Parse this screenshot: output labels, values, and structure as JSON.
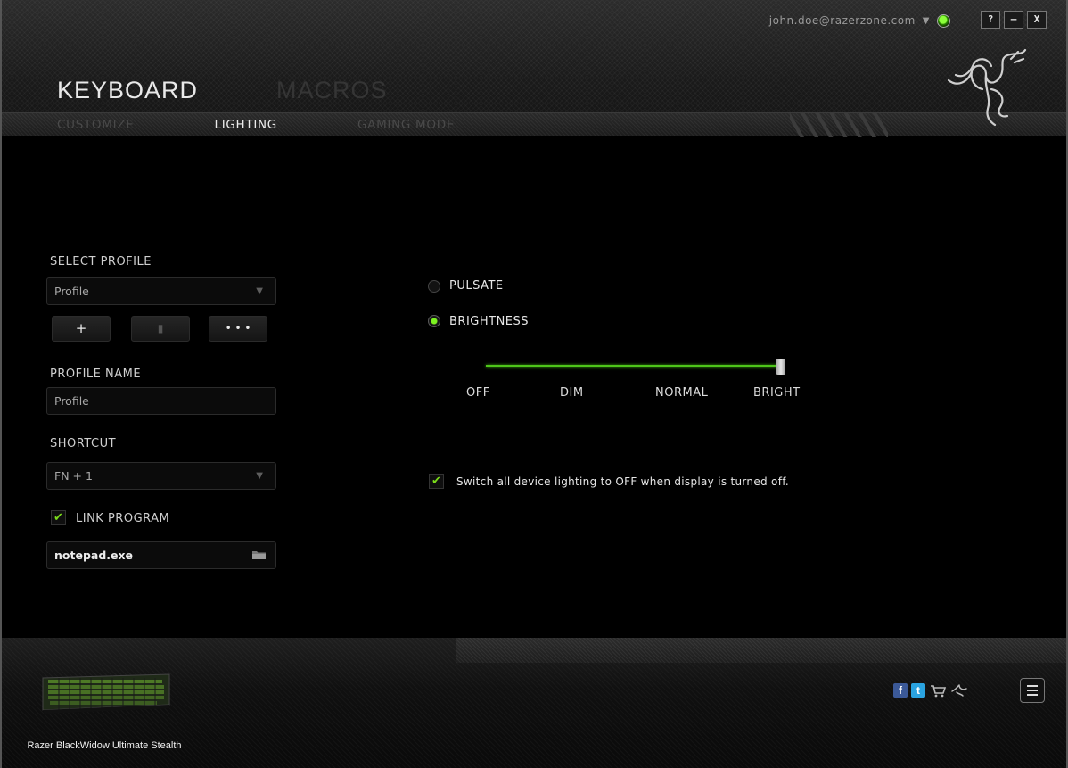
{
  "account": {
    "email": "john.doe@razerzone.com",
    "status": "online"
  },
  "window_controls": {
    "help": "?",
    "minimize": "–",
    "close": "X"
  },
  "main_tabs": [
    {
      "label": "KEYBOARD",
      "active": true
    },
    {
      "label": "MACROS",
      "active": false
    }
  ],
  "sub_tabs": [
    {
      "label": "CUSTOMIZE",
      "active": false
    },
    {
      "label": "LIGHTING",
      "active": true
    },
    {
      "label": "GAMING MODE",
      "active": false
    }
  ],
  "profile": {
    "select_label": "SELECT PROFILE",
    "selected": "Profile",
    "add_label": "+",
    "delete_label": "▮",
    "more_label": "• • •",
    "name_label": "PROFILE NAME",
    "name_value": "Profile",
    "shortcut_label": "SHORTCUT",
    "shortcut_value": "FN + 1",
    "link_program_label": "LINK PROGRAM",
    "link_program_checked": true,
    "program_value": "notepad.exe"
  },
  "lighting": {
    "pulsate_label": "PULSATE",
    "pulsate_selected": false,
    "brightness_label": "BRIGHTNESS",
    "brightness_selected": true,
    "brightness_level": "BRIGHT",
    "scale": [
      "OFF",
      "DIM",
      "NORMAL",
      "BRIGHT"
    ],
    "switch_off_label": "Switch all device lighting to OFF when display is turned off.",
    "switch_off_checked": true
  },
  "footer": {
    "device_name": "Razer BlackWidow Ultimate Stealth",
    "icons": [
      "facebook-icon",
      "twitter-icon",
      "store-icon",
      "razer-icon"
    ]
  },
  "colors": {
    "accent": "#7bdc1a",
    "background": "#000000"
  }
}
